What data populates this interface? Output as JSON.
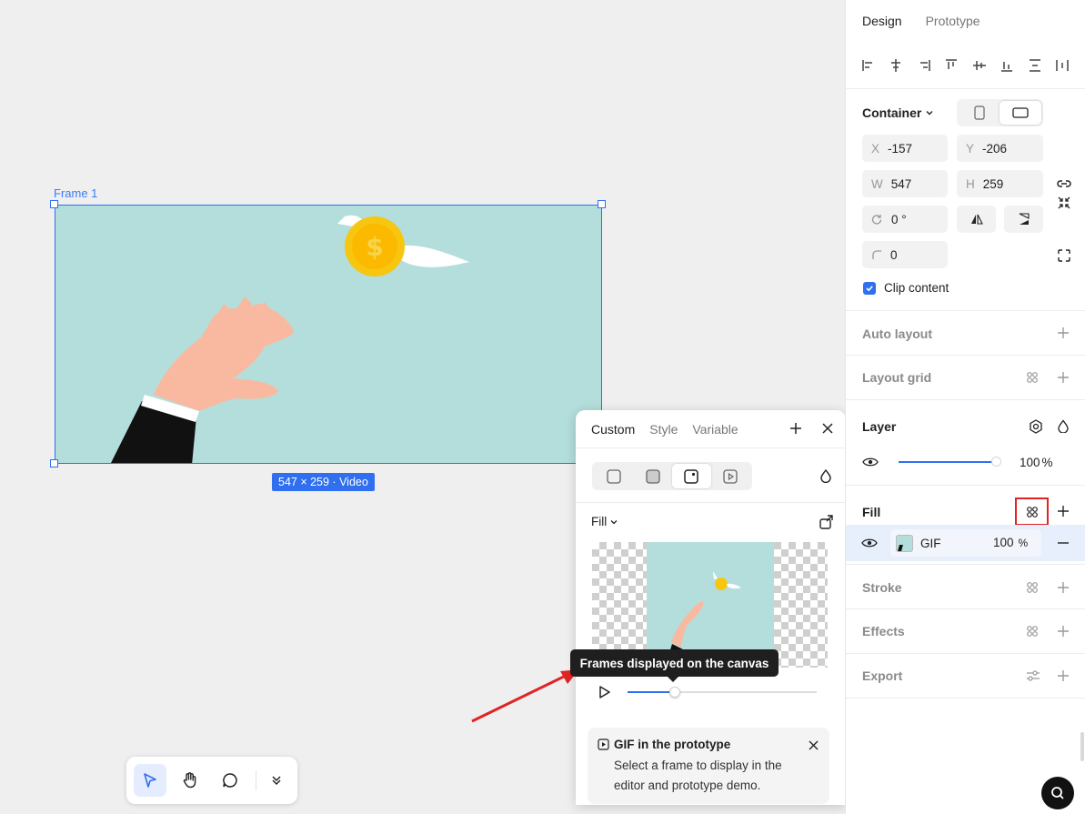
{
  "canvas": {
    "frame_label": "Frame 1",
    "size_badge": "547 × 259 · Video",
    "colors": {
      "frame_bg": "#b4dedb",
      "selection": "#2f6ff0"
    }
  },
  "toolbar": {
    "tools": [
      "move-icon",
      "hand-icon",
      "comment-icon",
      "chevron-double-down-icon"
    ]
  },
  "panel": {
    "tabs": {
      "design": "Design",
      "prototype": "Prototype"
    },
    "container": {
      "label": "Container",
      "x_label": "X",
      "x": "-157",
      "y_label": "Y",
      "y": "-206",
      "w_label": "W",
      "w": "547",
      "h_label": "H",
      "h": "259",
      "rotation": "0 °",
      "radius": "0",
      "clip_content": "Clip content"
    },
    "auto_layout": "Auto layout",
    "layout_grid": "Layout grid",
    "layer": {
      "title": "Layer",
      "opacity": "100",
      "opacity_unit": "%",
      "opacity_fraction": 0.97
    },
    "fill": {
      "title": "Fill",
      "item_name": "GIF",
      "item_opacity": "100",
      "item_unit": "%"
    },
    "stroke": "Stroke",
    "effects": "Effects",
    "export": "Export"
  },
  "popover": {
    "tabs": {
      "custom": "Custom",
      "style": "Style",
      "variable": "Variable"
    },
    "fill_dropdown": "Fill",
    "tooltip": "Frames displayed on the canvas",
    "slider_fraction": 0.25,
    "info": {
      "title": "GIF in the prototype",
      "body_line1": "Select a frame to display in the",
      "body_line2": "editor and prototype demo."
    }
  }
}
